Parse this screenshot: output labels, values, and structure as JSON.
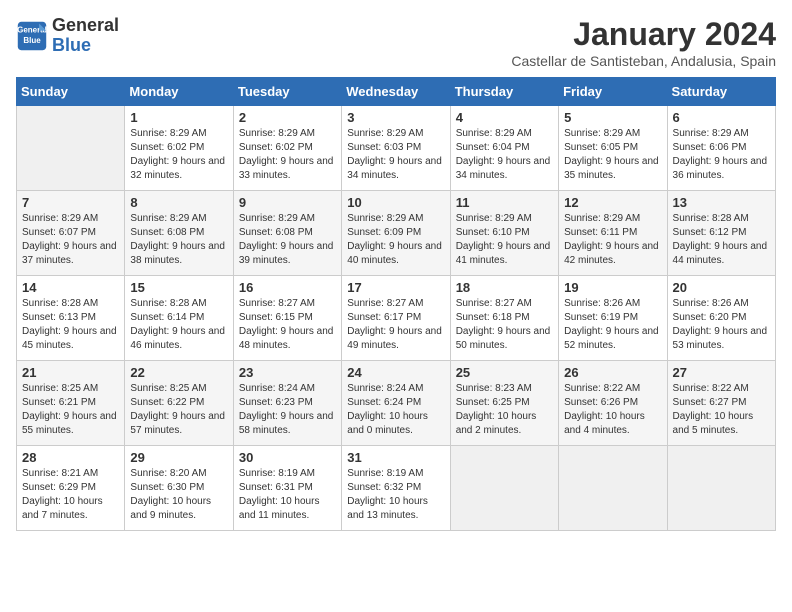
{
  "header": {
    "logo_line1": "General",
    "logo_line2": "Blue",
    "month_title": "January 2024",
    "location": "Castellar de Santisteban, Andalusia, Spain"
  },
  "weekdays": [
    "Sunday",
    "Monday",
    "Tuesday",
    "Wednesday",
    "Thursday",
    "Friday",
    "Saturday"
  ],
  "weeks": [
    [
      {
        "day": "",
        "sunrise": "",
        "sunset": "",
        "daylight": ""
      },
      {
        "day": "1",
        "sunrise": "Sunrise: 8:29 AM",
        "sunset": "Sunset: 6:02 PM",
        "daylight": "Daylight: 9 hours and 32 minutes."
      },
      {
        "day": "2",
        "sunrise": "Sunrise: 8:29 AM",
        "sunset": "Sunset: 6:02 PM",
        "daylight": "Daylight: 9 hours and 33 minutes."
      },
      {
        "day": "3",
        "sunrise": "Sunrise: 8:29 AM",
        "sunset": "Sunset: 6:03 PM",
        "daylight": "Daylight: 9 hours and 34 minutes."
      },
      {
        "day": "4",
        "sunrise": "Sunrise: 8:29 AM",
        "sunset": "Sunset: 6:04 PM",
        "daylight": "Daylight: 9 hours and 34 minutes."
      },
      {
        "day": "5",
        "sunrise": "Sunrise: 8:29 AM",
        "sunset": "Sunset: 6:05 PM",
        "daylight": "Daylight: 9 hours and 35 minutes."
      },
      {
        "day": "6",
        "sunrise": "Sunrise: 8:29 AM",
        "sunset": "Sunset: 6:06 PM",
        "daylight": "Daylight: 9 hours and 36 minutes."
      }
    ],
    [
      {
        "day": "7",
        "sunrise": "Sunrise: 8:29 AM",
        "sunset": "Sunset: 6:07 PM",
        "daylight": "Daylight: 9 hours and 37 minutes."
      },
      {
        "day": "8",
        "sunrise": "Sunrise: 8:29 AM",
        "sunset": "Sunset: 6:08 PM",
        "daylight": "Daylight: 9 hours and 38 minutes."
      },
      {
        "day": "9",
        "sunrise": "Sunrise: 8:29 AM",
        "sunset": "Sunset: 6:08 PM",
        "daylight": "Daylight: 9 hours and 39 minutes."
      },
      {
        "day": "10",
        "sunrise": "Sunrise: 8:29 AM",
        "sunset": "Sunset: 6:09 PM",
        "daylight": "Daylight: 9 hours and 40 minutes."
      },
      {
        "day": "11",
        "sunrise": "Sunrise: 8:29 AM",
        "sunset": "Sunset: 6:10 PM",
        "daylight": "Daylight: 9 hours and 41 minutes."
      },
      {
        "day": "12",
        "sunrise": "Sunrise: 8:29 AM",
        "sunset": "Sunset: 6:11 PM",
        "daylight": "Daylight: 9 hours and 42 minutes."
      },
      {
        "day": "13",
        "sunrise": "Sunrise: 8:28 AM",
        "sunset": "Sunset: 6:12 PM",
        "daylight": "Daylight: 9 hours and 44 minutes."
      }
    ],
    [
      {
        "day": "14",
        "sunrise": "Sunrise: 8:28 AM",
        "sunset": "Sunset: 6:13 PM",
        "daylight": "Daylight: 9 hours and 45 minutes."
      },
      {
        "day": "15",
        "sunrise": "Sunrise: 8:28 AM",
        "sunset": "Sunset: 6:14 PM",
        "daylight": "Daylight: 9 hours and 46 minutes."
      },
      {
        "day": "16",
        "sunrise": "Sunrise: 8:27 AM",
        "sunset": "Sunset: 6:15 PM",
        "daylight": "Daylight: 9 hours and 48 minutes."
      },
      {
        "day": "17",
        "sunrise": "Sunrise: 8:27 AM",
        "sunset": "Sunset: 6:17 PM",
        "daylight": "Daylight: 9 hours and 49 minutes."
      },
      {
        "day": "18",
        "sunrise": "Sunrise: 8:27 AM",
        "sunset": "Sunset: 6:18 PM",
        "daylight": "Daylight: 9 hours and 50 minutes."
      },
      {
        "day": "19",
        "sunrise": "Sunrise: 8:26 AM",
        "sunset": "Sunset: 6:19 PM",
        "daylight": "Daylight: 9 hours and 52 minutes."
      },
      {
        "day": "20",
        "sunrise": "Sunrise: 8:26 AM",
        "sunset": "Sunset: 6:20 PM",
        "daylight": "Daylight: 9 hours and 53 minutes."
      }
    ],
    [
      {
        "day": "21",
        "sunrise": "Sunrise: 8:25 AM",
        "sunset": "Sunset: 6:21 PM",
        "daylight": "Daylight: 9 hours and 55 minutes."
      },
      {
        "day": "22",
        "sunrise": "Sunrise: 8:25 AM",
        "sunset": "Sunset: 6:22 PM",
        "daylight": "Daylight: 9 hours and 57 minutes."
      },
      {
        "day": "23",
        "sunrise": "Sunrise: 8:24 AM",
        "sunset": "Sunset: 6:23 PM",
        "daylight": "Daylight: 9 hours and 58 minutes."
      },
      {
        "day": "24",
        "sunrise": "Sunrise: 8:24 AM",
        "sunset": "Sunset: 6:24 PM",
        "daylight": "Daylight: 10 hours and 0 minutes."
      },
      {
        "day": "25",
        "sunrise": "Sunrise: 8:23 AM",
        "sunset": "Sunset: 6:25 PM",
        "daylight": "Daylight: 10 hours and 2 minutes."
      },
      {
        "day": "26",
        "sunrise": "Sunrise: 8:22 AM",
        "sunset": "Sunset: 6:26 PM",
        "daylight": "Daylight: 10 hours and 4 minutes."
      },
      {
        "day": "27",
        "sunrise": "Sunrise: 8:22 AM",
        "sunset": "Sunset: 6:27 PM",
        "daylight": "Daylight: 10 hours and 5 minutes."
      }
    ],
    [
      {
        "day": "28",
        "sunrise": "Sunrise: 8:21 AM",
        "sunset": "Sunset: 6:29 PM",
        "daylight": "Daylight: 10 hours and 7 minutes."
      },
      {
        "day": "29",
        "sunrise": "Sunrise: 8:20 AM",
        "sunset": "Sunset: 6:30 PM",
        "daylight": "Daylight: 10 hours and 9 minutes."
      },
      {
        "day": "30",
        "sunrise": "Sunrise: 8:19 AM",
        "sunset": "Sunset: 6:31 PM",
        "daylight": "Daylight: 10 hours and 11 minutes."
      },
      {
        "day": "31",
        "sunrise": "Sunrise: 8:19 AM",
        "sunset": "Sunset: 6:32 PM",
        "daylight": "Daylight: 10 hours and 13 minutes."
      },
      {
        "day": "",
        "sunrise": "",
        "sunset": "",
        "daylight": ""
      },
      {
        "day": "",
        "sunrise": "",
        "sunset": "",
        "daylight": ""
      },
      {
        "day": "",
        "sunrise": "",
        "sunset": "",
        "daylight": ""
      }
    ]
  ]
}
